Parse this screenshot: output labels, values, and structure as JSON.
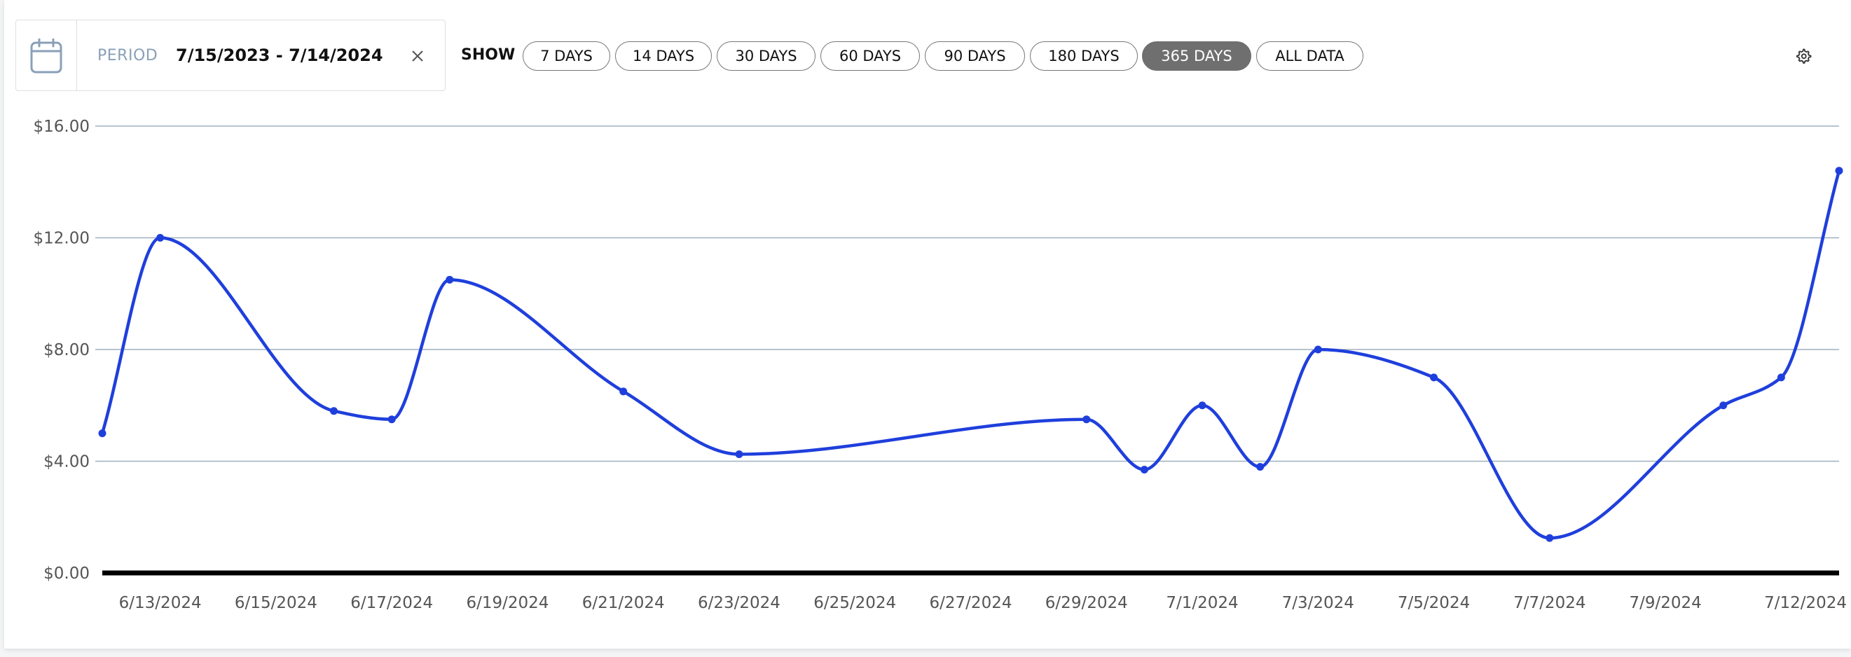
{
  "toolbar": {
    "period_label": "PERIOD",
    "period_value": "7/15/2023 - 7/14/2024",
    "show_label": "SHOW",
    "ranges": [
      "7 DAYS",
      "14 DAYS",
      "30 DAYS",
      "60 DAYS",
      "90 DAYS",
      "180 DAYS",
      "365 DAYS",
      "ALL DATA"
    ],
    "selected_range": "365 DAYS",
    "icons": {
      "calendar": "calendar-icon",
      "clear": "close-icon",
      "settings": "gear-icon"
    }
  },
  "chart_data": {
    "type": "line",
    "title": "",
    "xlabel": "",
    "ylabel": "",
    "x": [
      "6/12/2024",
      "6/13/2024",
      "6/16/2024",
      "6/17/2024",
      "6/18/2024",
      "6/21/2024",
      "6/23/2024",
      "6/29/2024",
      "6/30/2024",
      "7/1/2024",
      "7/2/2024",
      "7/3/2024",
      "7/5/2024",
      "7/7/2024",
      "7/10/2024",
      "7/11/2024",
      "7/12/2024"
    ],
    "series": [
      {
        "values": [
          5.0,
          12.0,
          5.8,
          5.5,
          10.5,
          6.5,
          4.25,
          5.5,
          3.7,
          6.0,
          3.8,
          8.0,
          7.0,
          1.25,
          6.0,
          7.0,
          14.4
        ]
      }
    ],
    "x_ticks": [
      "6/13/2024",
      "6/15/2024",
      "6/17/2024",
      "6/19/2024",
      "6/21/2024",
      "6/23/2024",
      "6/25/2024",
      "6/27/2024",
      "6/29/2024",
      "7/1/2024",
      "7/3/2024",
      "7/5/2024",
      "7/7/2024",
      "7/9/2024",
      "7/12/2024"
    ],
    "y_ticks": [
      "$0.00",
      "$4.00",
      "$8.00",
      "$12.00",
      "$16.00"
    ],
    "ylim": [
      0,
      16
    ],
    "xlim": [
      "6/12/2024",
      "7/12/2024"
    ],
    "grid": true,
    "colors": {
      "line": "#1f3fdc",
      "grid": "#9fb0bd",
      "baseline": "#000000"
    }
  }
}
